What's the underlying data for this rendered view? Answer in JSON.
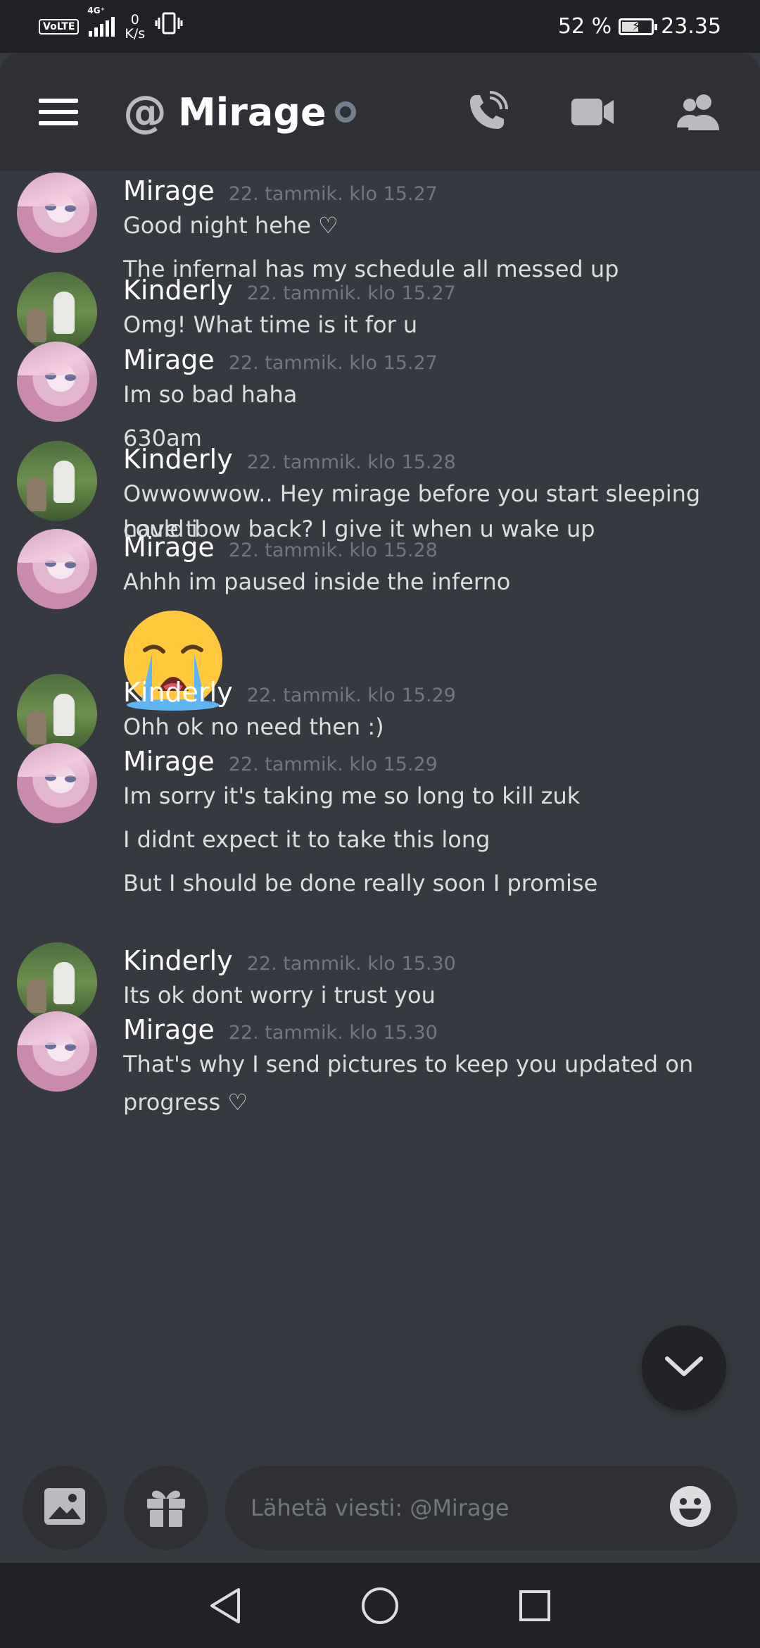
{
  "status_bar": {
    "volte": "VoLTE",
    "network": "4G⁺",
    "speed_value": "0",
    "speed_unit": "K/s",
    "battery": "52 %",
    "battery_level_percent": 52,
    "time": "23.35"
  },
  "header": {
    "channel_name": "Mirage",
    "icons": [
      "menu-icon",
      "at-icon",
      "status-dot",
      "call-icon",
      "video-icon",
      "members-icon"
    ]
  },
  "messages": [
    {
      "author": "Mirage",
      "time": "22. tammik. klo 15.27",
      "lines": [
        "Good night hehe ♡",
        "The infernal has my schedule all messed up"
      ]
    },
    {
      "author": "Kinderly",
      "time": "22. tammik. klo 15.27",
      "lines": [
        "Omg! What time is it for u"
      ]
    },
    {
      "author": "Mirage",
      "time": "22. tammik. klo 15.27",
      "lines": [
        "Im so bad haha",
        "630am"
      ]
    },
    {
      "author": "Kinderly",
      "time": "22. tammik. klo 15.28",
      "lines": [
        "Owwowwow.. Hey mirage before you start sleeping could i",
        "have tbow back? I give it when u wake up"
      ]
    },
    {
      "author": "Mirage",
      "time": "22. tammik. klo 15.28",
      "lines": [
        "Ahhh im paused inside the inferno"
      ],
      "emoji": "loudly-crying-face"
    },
    {
      "author": "Kinderly",
      "time": "22. tammik. klo 15.29",
      "lines": [
        "Ohh ok no need then :)"
      ]
    },
    {
      "author": "Mirage",
      "time": "22. tammik. klo 15.29",
      "lines": [
        "Im sorry it's taking me so long to kill zuk",
        "I didnt expect it to take this long",
        "But I should be done really soon I promise"
      ]
    },
    {
      "author": "Kinderly",
      "time": "22. tammik. klo 15.30",
      "lines": [
        "Its ok dont worry i trust you"
      ]
    },
    {
      "author": "Mirage",
      "time": "22. tammik. klo 15.30",
      "lines": [
        "That's why I send pictures to keep you updated on",
        "progress ♡"
      ]
    }
  ],
  "composer": {
    "placeholder": "Lähetä viesti: @Mirage",
    "icons": [
      "image-icon",
      "gift-icon",
      "emoji-icon"
    ]
  },
  "navigation": {
    "icons": [
      "back-icon",
      "home-icon",
      "recents-icon"
    ]
  },
  "colors": {
    "background": "#36393f",
    "header": "#2f3136",
    "status_bar": "#202225",
    "text": "#dcddde",
    "timestamp": "#72767d"
  }
}
